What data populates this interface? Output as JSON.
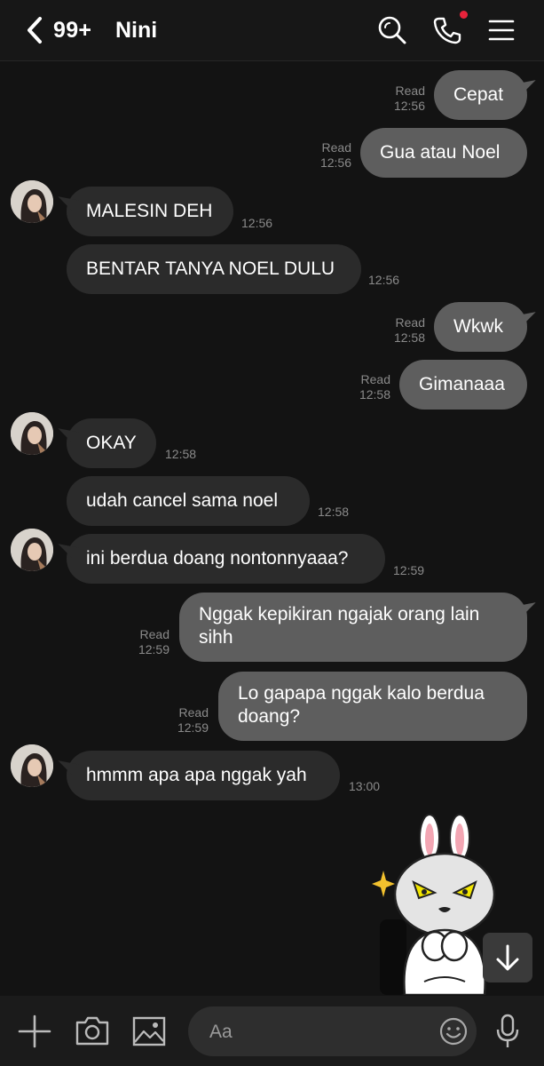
{
  "header": {
    "unread_count": "99+",
    "chat_name": "Nini",
    "icons": [
      "chevron-left-icon",
      "search-icon",
      "phone-icon",
      "menu-icon"
    ],
    "call_indicator_color": "#e8233b"
  },
  "messages": [
    {
      "side": "out",
      "text": "Cepat",
      "read": "Read",
      "time": "12:56"
    },
    {
      "side": "out",
      "text": "Gua atau Noel",
      "read": "Read",
      "time": "12:56"
    },
    {
      "side": "in",
      "text": "MALESIN DEH",
      "time": "12:56"
    },
    {
      "side": "in",
      "text": "BENTAR TANYA NOEL DULU",
      "time": "12:56"
    },
    {
      "side": "out",
      "text": "Wkwk",
      "read": "Read",
      "time": "12:58"
    },
    {
      "side": "out",
      "text": "Gimanaaa",
      "read": "Read",
      "time": "12:58"
    },
    {
      "side": "in",
      "text": "OKAY",
      "time": "12:58"
    },
    {
      "side": "in",
      "text": "udah cancel sama noel",
      "time": "12:58"
    },
    {
      "side": "in",
      "text": "ini berdua doang nontonnyaaa?",
      "time": "12:59"
    },
    {
      "side": "out",
      "text": "Nggak kepikiran ngajak orang lain sihh",
      "read": "Read",
      "time": "12:59"
    },
    {
      "side": "out",
      "text": "Lo gapapa nggak kalo berdua doang?",
      "read": "Read",
      "time": "12:59"
    },
    {
      "side": "in",
      "text": "hmmm apa apa nggak yah",
      "time": "13:00"
    }
  ],
  "sticker": {
    "icon": "angry-bunny-sticker"
  },
  "composer": {
    "placeholder": "Aa",
    "icons": [
      "plus-icon",
      "camera-icon",
      "image-icon",
      "emoji-icon",
      "microphone-icon"
    ]
  },
  "colors": {
    "background": "#131313",
    "outgoing_bubble": "#5e5e5e",
    "incoming_bubble": "#2b2b2b"
  }
}
